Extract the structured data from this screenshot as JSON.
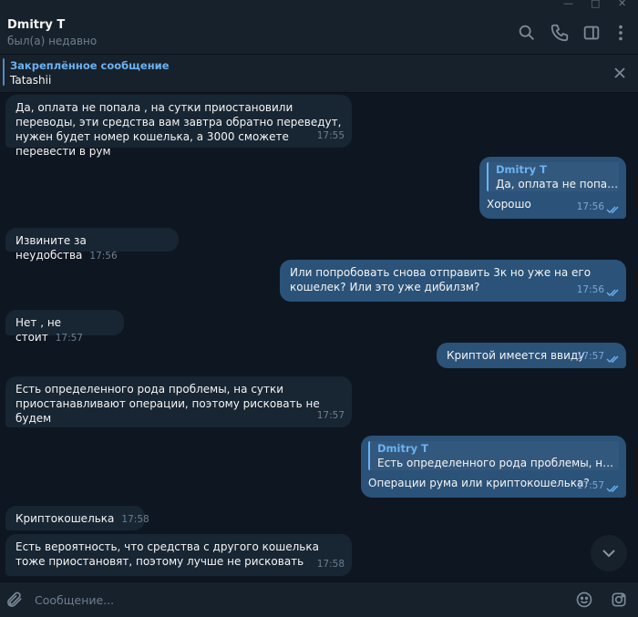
{
  "header": {
    "title": "Dmitry T",
    "status": "был(а) недавно"
  },
  "pinned": {
    "title": "Закреплённое сообщение",
    "text": "Tatashii"
  },
  "messages": [
    {
      "dir": "in",
      "text": "Да, оплата не попала , на сутки приостановили переводы, эти средства вам завтра обратно переведут, нужен будет номер кошелька, а 3000 сможете перевести в рум",
      "time": "17:55"
    },
    {
      "dir": "out",
      "reply_name": "Dmitry T",
      "reply_text": "Да, оплата не попала ...",
      "text": "Хорошо",
      "time": "17:56",
      "read": true
    },
    {
      "dir": "in",
      "text": "Извините за неудобства",
      "time": "17:56"
    },
    {
      "dir": "out",
      "text": "Или попробовать снова отправить 3к но уже на его кошелек? Или это уже дибилзм?",
      "time": "17:56",
      "read": true
    },
    {
      "dir": "in",
      "text": "Нет , не стоит",
      "time": "17:57"
    },
    {
      "dir": "out",
      "text": "Криптой имеется ввиду",
      "time": "17:57",
      "read": true
    },
    {
      "dir": "in",
      "text": "Есть определенного рода проблемы, на сутки приостанавливают операции, поэтому рисковать не будем",
      "time": "17:57"
    },
    {
      "dir": "out",
      "reply_name": "Dmitry T",
      "reply_text": "Есть определенного рода проблемы, на сутк...",
      "text": "Операции рума или криптокошелька?",
      "time": "17:57",
      "read": true
    },
    {
      "dir": "in",
      "text": "Криптокошелька",
      "time": "17:58"
    },
    {
      "dir": "in",
      "text": "Есть вероятность, что средства с другого кошелька тоже приостановят, поэтому лучше не рисковать",
      "time": "17:58"
    }
  ],
  "composer": {
    "placeholder": "Сообщение..."
  },
  "icons": {
    "header": [
      "search-icon",
      "phone-icon",
      "sidebar-toggle-icon",
      "more-vertical-icon"
    ],
    "pinned_close": "close-icon",
    "scroll": "chevron-down-icon",
    "composer": [
      "paperclip-icon",
      "emoji-icon",
      "instagram-icon"
    ]
  },
  "colors": {
    "background": "#0e1621",
    "panel": "#17212b",
    "incoming_bubble": "#182533",
    "outgoing_bubble": "#2b5278",
    "accent": "#6ab3f3"
  }
}
